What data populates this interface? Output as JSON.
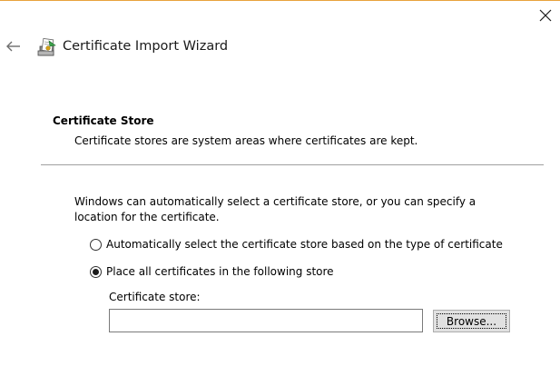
{
  "window": {
    "accent_color": "#e8a33d",
    "close_icon": "close-icon",
    "back_icon": "back-arrow-icon"
  },
  "wizard": {
    "title": "Certificate Import Wizard",
    "icon": "certificate-wizard-icon"
  },
  "section": {
    "heading": "Certificate Store",
    "description": "Certificate stores are system areas where certificates are kept."
  },
  "intro": {
    "text": "Windows can automatically select a certificate store, or you can specify a location for the certificate."
  },
  "options": [
    {
      "label": "Automatically select the certificate store based on the type of certificate",
      "checked": false
    },
    {
      "label": "Place all certificates in the following store",
      "checked": true
    }
  ],
  "store": {
    "label": "Certificate store:",
    "value": "",
    "browse_label": "Browse..."
  }
}
